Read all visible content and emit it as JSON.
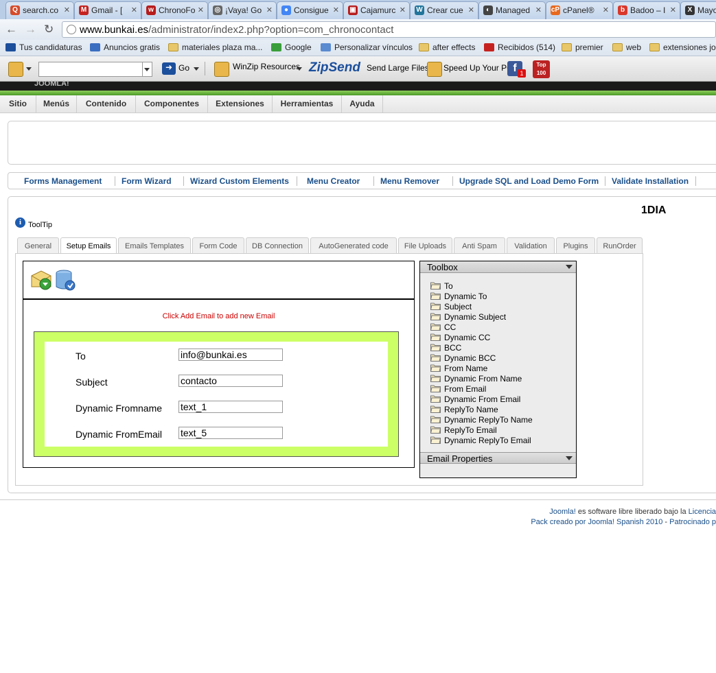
{
  "browser": {
    "tabs": [
      {
        "label": "search.co",
        "color": "#d64b2a",
        "glyph": "Q"
      },
      {
        "label": "Gmail - [",
        "color": "#c5221f",
        "glyph": "M"
      },
      {
        "label": "ChronoFo",
        "color": "#b71c1c",
        "glyph": "w"
      },
      {
        "label": "¡Vaya! Go",
        "color": "#666666",
        "glyph": "◎"
      },
      {
        "label": "Consigue",
        "color": "#4285f4",
        "glyph": "●"
      },
      {
        "label": "Cajamurc",
        "color": "#b71c1c",
        "glyph": "▣"
      },
      {
        "label": "Crear cue",
        "color": "#21759b",
        "glyph": "W"
      },
      {
        "label": "Managed",
        "color": "#444444",
        "glyph": "◐"
      },
      {
        "label": "cPanel®",
        "color": "#e8681e",
        "glyph": "cP"
      },
      {
        "label": "Badoo – I",
        "color": "#d9372b",
        "glyph": "b"
      },
      {
        "label": "Mayo",
        "color": "#333333",
        "glyph": "X"
      }
    ],
    "url_host": "www.bunkai.es",
    "url_path": "/administrator/index2.php?option=com_chronocontact",
    "bookmarks": [
      {
        "label": "Tus candidaturas",
        "type": "site",
        "color": "#1c4f9c"
      },
      {
        "label": "Anuncios gratis",
        "type": "site",
        "color": "#3a6ec0"
      },
      {
        "label": "materiales plaza ma...",
        "type": "folder"
      },
      {
        "label": "Google",
        "type": "site",
        "color": "#3a9e3a"
      },
      {
        "label": "Personalizar vínculos",
        "type": "site",
        "color": "#5b8bd0"
      },
      {
        "label": "after effects",
        "type": "folder"
      },
      {
        "label": "Recibidos (514)",
        "type": "site",
        "color": "#c5221f"
      },
      {
        "label": "premier",
        "type": "folder"
      },
      {
        "label": "web",
        "type": "folder"
      },
      {
        "label": "extensiones joo",
        "type": "folder"
      }
    ],
    "toolbar": {
      "go_label": "Go",
      "winzip_label": "WinZip Resources",
      "zipsend_label": "ZipSend",
      "send_large_label": "Send Large Files",
      "speed_label": "Speed Up Your PC",
      "fb_badge": "1",
      "top100_label": "Top 100"
    }
  },
  "joomla": {
    "logo": "JOOMLA!",
    "menu": [
      "Sitio",
      "Menús",
      "Contenido",
      "Componentes",
      "Extensiones",
      "Herramientas",
      "Ayuda"
    ],
    "submenu": [
      "Forms Management",
      "Form Wizard",
      "Wizard Custom Elements",
      "Menu Creator",
      "Menu Remover",
      "Upgrade SQL and Load Demo Form",
      "Validate Installation"
    ],
    "form_name": "1DIA",
    "tooltip_label": "ToolTip",
    "tabs": [
      "General",
      "Setup Emails",
      "Emails Templates",
      "Form Code",
      "DB Connection",
      "AutoGenerated code",
      "File Uploads",
      "Anti Spam",
      "Validation",
      "Plugins",
      "RunOrder"
    ],
    "active_tab": "Setup Emails",
    "click_message": "Click Add Email to add new Email",
    "email_fields": [
      {
        "label": "To",
        "value": "info@bunkai.es"
      },
      {
        "label": "Subject",
        "value": "contacto"
      },
      {
        "label": "Dynamic Fromname",
        "value": "text_1"
      },
      {
        "label": "Dynamic FromEmail",
        "value": "text_5"
      }
    ],
    "email_box_color": "#ccff66",
    "toolbox_title": "Toolbox",
    "toolbox_items": [
      "To",
      "Dynamic To",
      "Subject",
      "Dynamic Subject",
      "CC",
      "Dynamic CC",
      "BCC",
      "Dynamic BCC",
      "From Name",
      "Dynamic From Name",
      "From Email",
      "Dynamic From Email",
      "ReplyTo Name",
      "Dynamic ReplyTo Name",
      "ReplyTo Email",
      "Dynamic ReplyTo Email"
    ],
    "email_properties_title": "Email Properties",
    "footer_line1_link": "Joomla!",
    "footer_line1_text": " es software libre liberado bajo la ",
    "footer_line1_link2": "Licencia",
    "footer_line2": "Pack creado por Joomla! Spanish 2010",
    "footer_line2_sep": " - ",
    "footer_line2_link": "Patrocinado p"
  }
}
